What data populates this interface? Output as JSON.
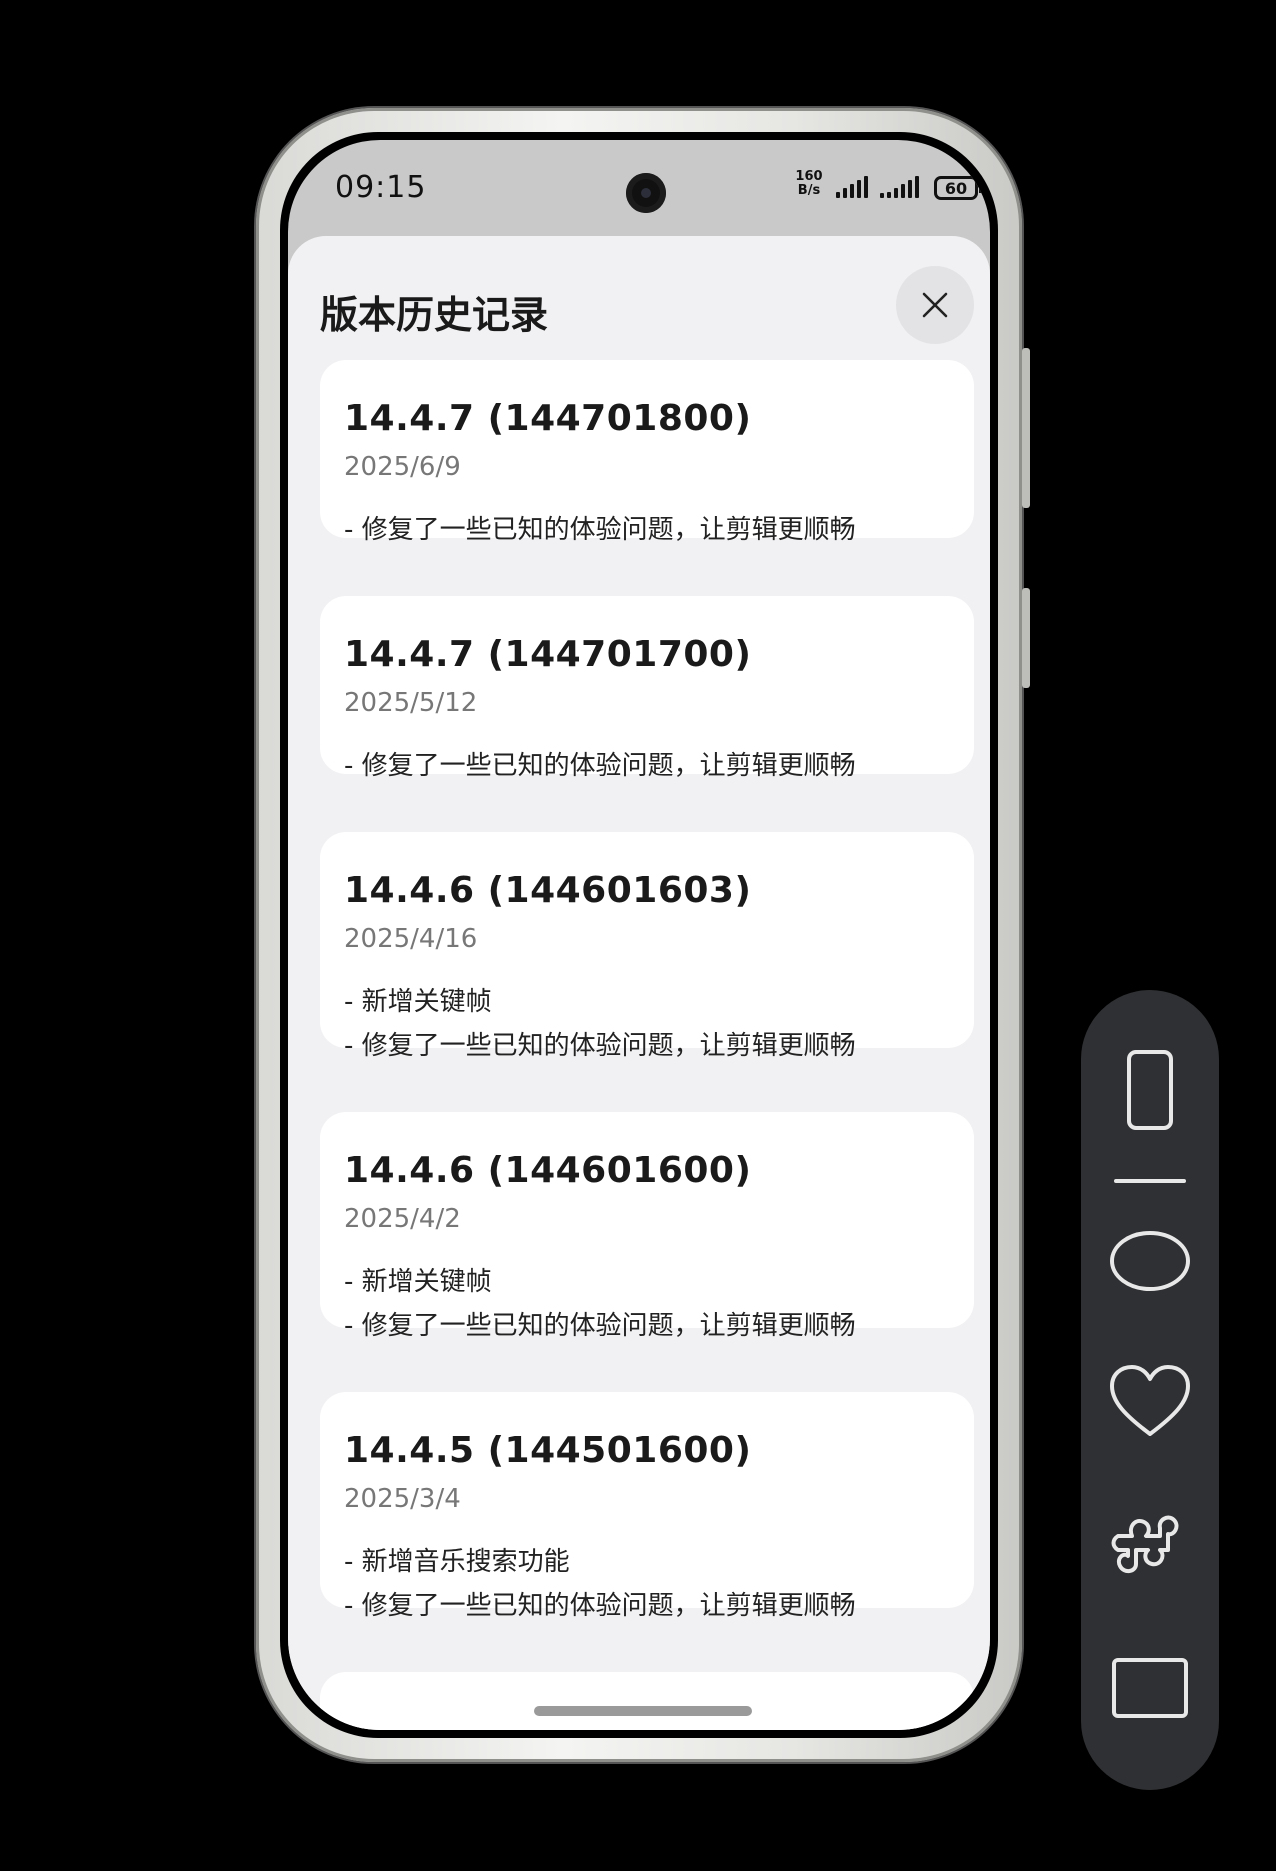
{
  "status_bar": {
    "time": "09:15",
    "speed_value": "160",
    "speed_unit": "B/s",
    "battery": "60"
  },
  "sheet": {
    "title": "版本历史记录",
    "close_icon": "close-icon"
  },
  "versions": [
    {
      "version": "14.4.7 (144701800)",
      "date": "2025/6/9",
      "notes": [
        "- 修复了一些已知的体验问题，让剪辑更顺畅"
      ]
    },
    {
      "version": "14.4.7 (144701700)",
      "date": "2025/5/12",
      "notes": [
        "- 修复了一些已知的体验问题，让剪辑更顺畅"
      ]
    },
    {
      "version": "14.4.6 (144601603)",
      "date": "2025/4/16",
      "notes": [
        "- 新增关键帧",
        "- 修复了一些已知的体验问题，让剪辑更顺畅"
      ]
    },
    {
      "version": "14.4.6 (144601600)",
      "date": "2025/4/2",
      "notes": [
        "- 新增关键帧",
        "- 修复了一些已知的体验问题，让剪辑更顺畅"
      ]
    },
    {
      "version": "14.4.5 (144501600)",
      "date": "2025/3/4",
      "notes": [
        "- 新增音乐搜索功能",
        "- 修复了一些已知的体验问题，让剪辑更顺畅"
      ]
    }
  ],
  "toolbar": {
    "icons": [
      "phone-frame-icon",
      "line-icon",
      "ellipse-icon",
      "heart-icon",
      "puzzle-icon",
      "rectangle-icon"
    ]
  }
}
